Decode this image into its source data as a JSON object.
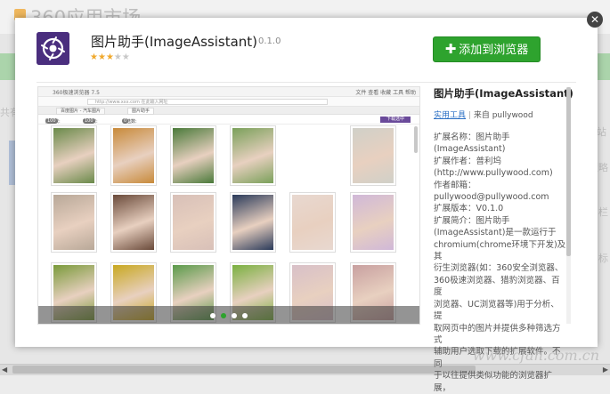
{
  "background": {
    "title": "360应用市场",
    "side_left": "共有",
    "side_right_1": "网站",
    "side_right_2": "策略",
    "side_right_3": "栏",
    "side_right_4": "标"
  },
  "modal": {
    "close_icon": "close-icon",
    "app": {
      "name": "图片助手(ImageAssistant)",
      "version": "0.1.0",
      "rating": 3,
      "rating_max": 5,
      "icon": "app-icon"
    },
    "add_button": {
      "label": "添加到浏览器",
      "color": "#2ea32e"
    },
    "screenshot": {
      "window_title": "360极速浏览器 7.5",
      "menu": "文件  查看  收藏  工具  帮助",
      "address_placeholder": "http://www.xxx.com 在此输入网址",
      "tabs": [
        "百度图片 - 汽车图片",
        "图片助手"
      ],
      "toolbar": [
        {
          "label": "图片数:",
          "count": "100"
        },
        {
          "label": "可见数:",
          "count": "100"
        },
        {
          "label": "已选数:",
          "count": "0"
        }
      ],
      "toolbar_button": "下载选中",
      "photo_colors": [
        [
          "#6a8a4a",
          "#c88a3a",
          "#4a7a3a",
          "#7aa05a",
          "#d0d0c8"
        ],
        [
          "#b8a898",
          "#6a4a3a",
          "#d8c0b8",
          "#2a3a5a",
          "#e8d8d0",
          "#d0b8d8"
        ],
        [
          "#7a9a3a",
          "#c8a820",
          "#5a9a4a",
          "#7ab040",
          "#d8c0c8",
          "#c8a0a0"
        ]
      ],
      "slider_dots": 4,
      "slider_active": 1
    },
    "description": {
      "title": "图片助手(ImageAssistant)",
      "category": "实用工具",
      "separator": "|",
      "source_prefix": "来自",
      "author": "pullywood",
      "body": "扩展名称：图片助手\n(ImageAssistant)\n扩展作者：普利坞\n(http://www.pullywood.com)\n作者邮箱：\npullywood@pullywood.com\n扩展版本：V0.1.0\n扩展简介：图片助手\n(ImageAssistant)是一款运行于\nchromium(chrome环境下开发)及其\n衍生浏览器(如：360安全浏览器、\n360极速浏览器、猎豹浏览器、百度\n浏览器、UC浏览器等)用于分析、提\n取网页中的图片并提供多种筛选方式\n辅助用户选取下载的扩展软件。不同\n于以往提供类似功能的浏览器扩展，"
    }
  },
  "watermark": "www.cfan.com.cn"
}
